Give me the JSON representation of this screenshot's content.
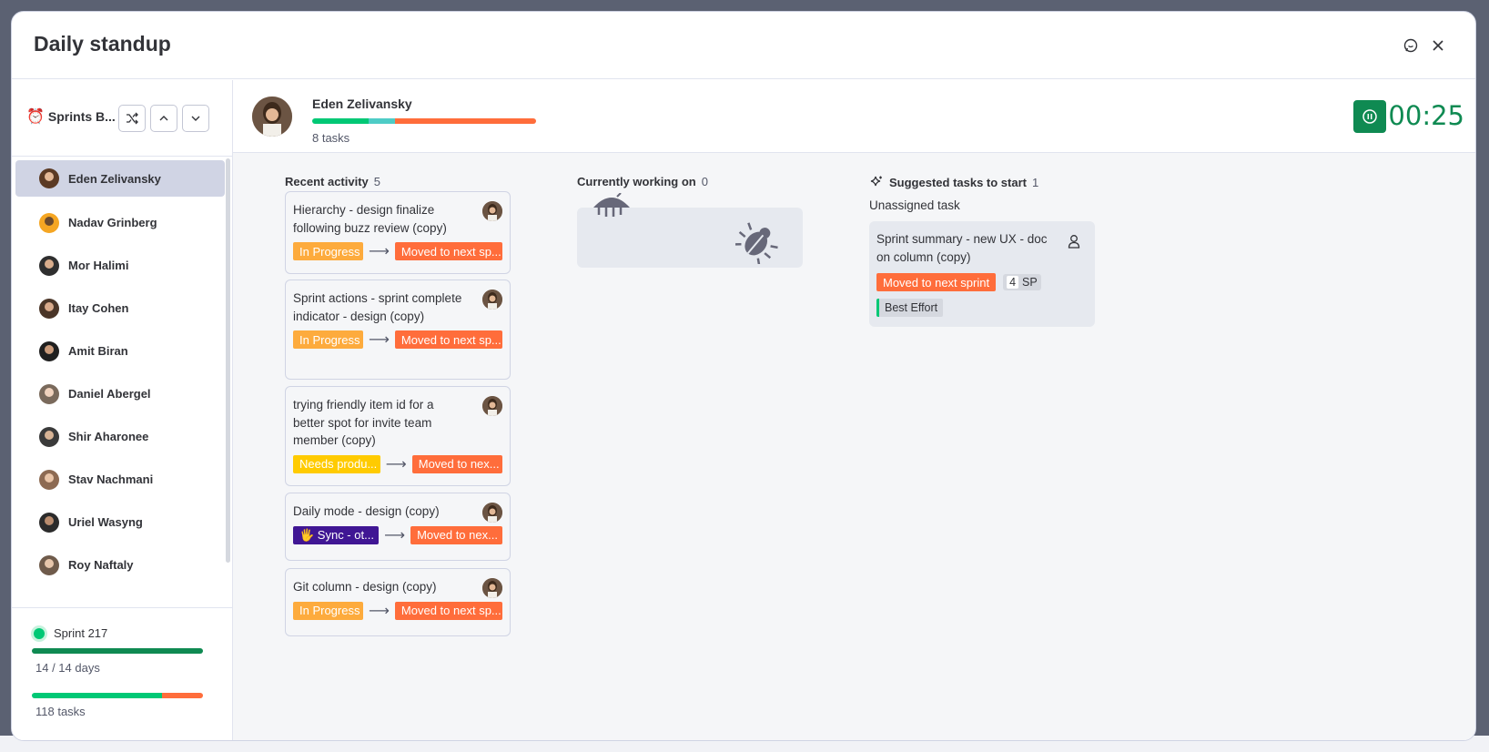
{
  "modal": {
    "title": "Daily standup"
  },
  "sidebar": {
    "board_name": "Sprints B...",
    "people": [
      {
        "name": "Eden Zelivansky",
        "selected": true
      },
      {
        "name": "Nadav Grinberg"
      },
      {
        "name": "Mor Halimi"
      },
      {
        "name": "Itay Cohen"
      },
      {
        "name": "Amit Biran"
      },
      {
        "name": "Daniel Abergel"
      },
      {
        "name": "Shir Aharonee"
      },
      {
        "name": "Stav Nachmani"
      },
      {
        "name": "Uriel Wasyng"
      },
      {
        "name": "Roy Naftaly"
      }
    ],
    "sprint": {
      "name": "Sprint 217",
      "days_label": "14 / 14 days",
      "days_progress": 1.0,
      "tasks_label": "118 tasks",
      "tasks_done_fraction": 0.76
    }
  },
  "user": {
    "name": "Eden Zelivansky",
    "tasks_label": "8 tasks",
    "progress": {
      "done": 0.25,
      "working": 0.12,
      "stuck": 0.63
    }
  },
  "timer": {
    "value": "00:25"
  },
  "columns": {
    "recent": {
      "title": "Recent activity",
      "count": "5"
    },
    "working": {
      "title": "Currently working on",
      "count": "0"
    },
    "suggested": {
      "title": "Suggested tasks to start",
      "count": "1"
    }
  },
  "recent_cards": [
    {
      "title": "Hierarchy - design finalize following buzz review (copy)",
      "from": "In Progress",
      "to": "Moved to next sp..."
    },
    {
      "title": "Sprint actions - sprint complete indicator - design (copy)",
      "from": "In Progress",
      "to": "Moved to next sp..."
    },
    {
      "title": "trying friendly item id for a better spot for invite team member (copy)",
      "from": "Needs produ...",
      "to": "Moved to nex..."
    },
    {
      "title": "Daily mode - design (copy)",
      "from": "🖐 Sync - ot...",
      "to": "Moved to nex..."
    },
    {
      "title": "Git column - design (copy)",
      "from": "In Progress",
      "to": "Moved to next sp..."
    }
  ],
  "suggested": {
    "section_label": "Unassigned task",
    "title": "Sprint summary - new UX - doc on column (copy)",
    "status": "Moved to next sprint",
    "sp_value": "4",
    "sp_label": "SP",
    "effort": "Best Effort"
  },
  "colors": {
    "green": "#00c875",
    "teal": "#4eccc6",
    "orange": "#ff6d3b",
    "in_progress": "#fdab3d",
    "needs": "#ffcb00",
    "sync": "#401694",
    "timer": "#0f8a52"
  }
}
